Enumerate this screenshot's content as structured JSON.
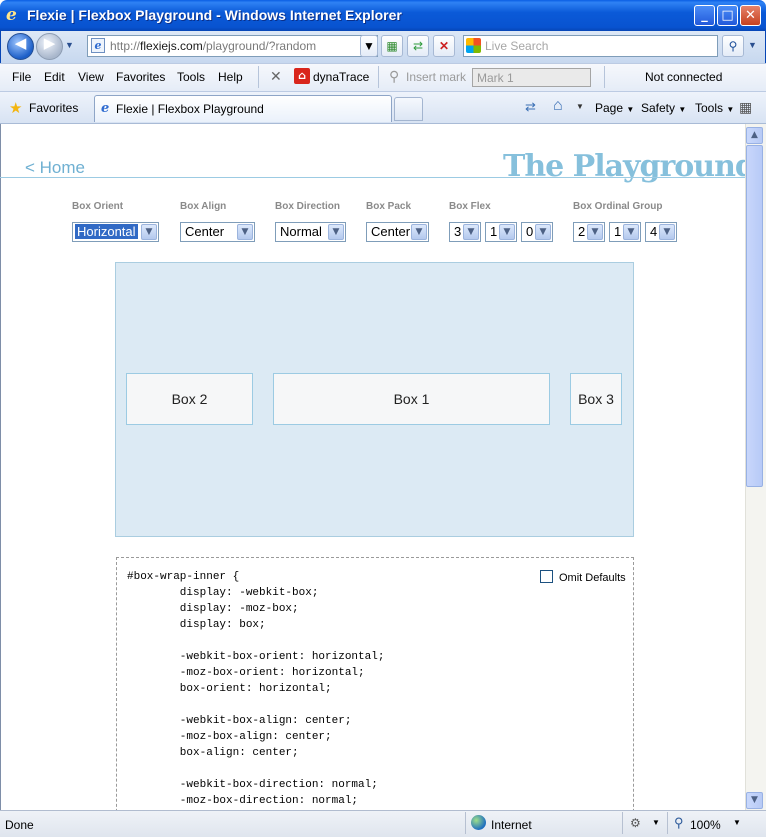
{
  "window": {
    "title": "Flexie | Flexbox Playground - Windows Internet Explorer",
    "minimize": "_",
    "maximize": "□",
    "close": "✕"
  },
  "address": {
    "url_prefix": "http://",
    "url_domain": "flexiejs.com",
    "url_path": "/playground/?random",
    "search_placeholder": "Live Search"
  },
  "menu": {
    "items": [
      "File",
      "Edit",
      "View",
      "Favorites",
      "Tools",
      "Help"
    ],
    "dynatrace": "dynaTrace",
    "insert_mark": "Insert mark",
    "mark_field": "Mark 1",
    "status": "Not connected"
  },
  "favbar": {
    "favorites": "Favorites",
    "tab_title": "Flexie | Flexbox Playground",
    "page": "Page",
    "safety": "Safety",
    "tools": "Tools"
  },
  "page": {
    "home_link": "< Home",
    "title": "The Playground",
    "controls": {
      "orient": {
        "label": "Box Orient",
        "value": "Horizontal"
      },
      "align": {
        "label": "Box Align",
        "value": "Center"
      },
      "direction": {
        "label": "Box Direction",
        "value": "Normal"
      },
      "pack": {
        "label": "Box Pack",
        "value": "Center"
      },
      "flex": {
        "label": "Box Flex",
        "values": [
          "3",
          "1",
          "0"
        ]
      },
      "ordinal": {
        "label": "Box Ordinal Group",
        "values": [
          "2",
          "1",
          "4"
        ]
      }
    },
    "boxes": [
      "Box 2",
      "Box 1",
      "Box 3"
    ],
    "omit_defaults": "Omit Defaults",
    "code": "#box-wrap-inner {\n        display: -webkit-box;\n        display: -moz-box;\n        display: box;\n\n        -webkit-box-orient: horizontal;\n        -moz-box-orient: horizontal;\n        box-orient: horizontal;\n\n        -webkit-box-align: center;\n        -moz-box-align: center;\n        box-align: center;\n\n        -webkit-box-direction: normal;\n        -moz-box-direction: normal;"
  },
  "statusbar": {
    "left": "Done",
    "zone": "Internet",
    "zoom": "100%"
  }
}
